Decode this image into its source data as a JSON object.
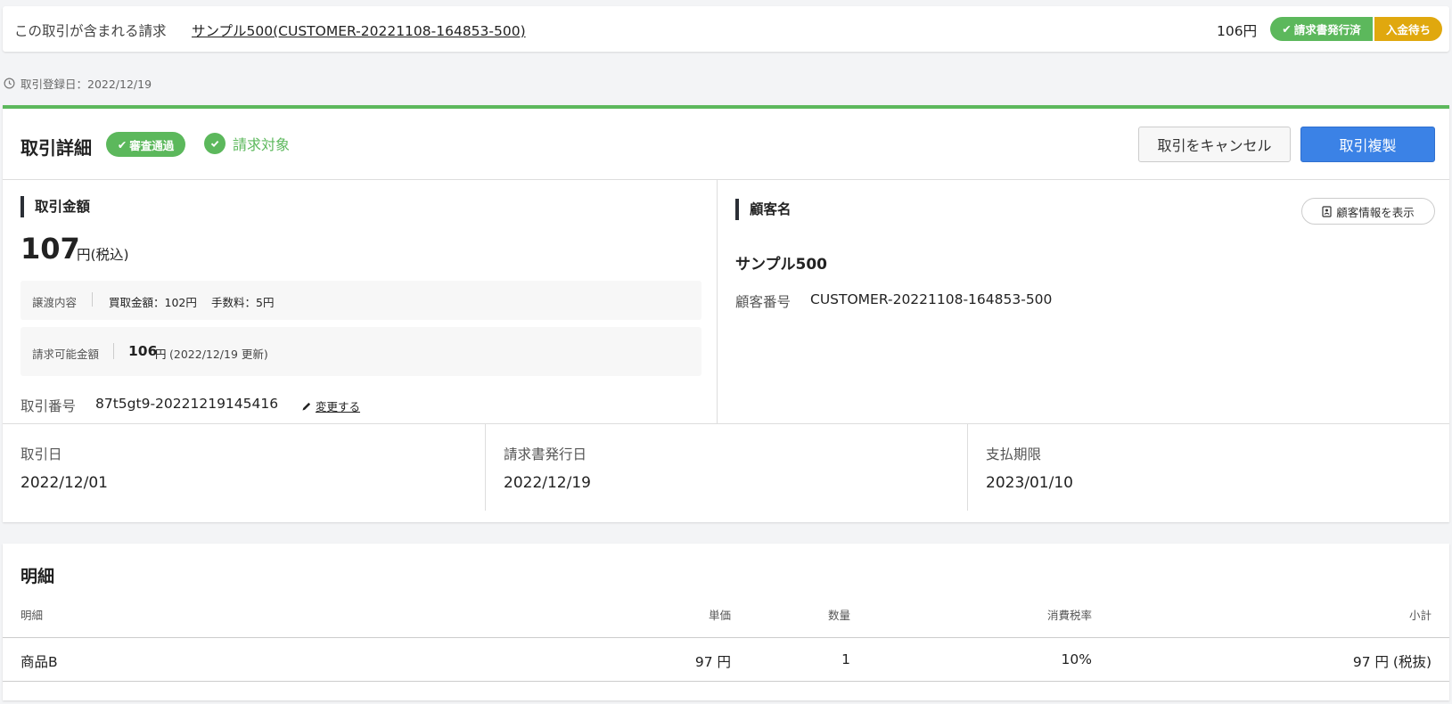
{
  "billing": {
    "label": "この取引が含まれる請求",
    "link": "サンプル500(CUSTOMER-20221108-164853-500)",
    "amount": "106円",
    "badge_issued": "請求書発行済",
    "badge_waiting": "入金待ち"
  },
  "registration": {
    "text": "取引登録日：2022/12/19"
  },
  "detail": {
    "title": "取引詳細",
    "badge_approved": "審査通過",
    "billing_target": "請求対象",
    "cancel_label": "取引をキャンセル",
    "duplicate_label": "取引複製"
  },
  "amount": {
    "label": "取引金額",
    "value": "107",
    "unit": "円(税込)",
    "transfer_label": "譲渡内容",
    "purchase": "買取金額：102円",
    "fee": "手数料：5円",
    "billable_label": "請求可能金額",
    "billable_value": "106",
    "billable_unit": "円",
    "billable_note": "(2022/12/19 更新)",
    "deal_no_label": "取引番号",
    "deal_no_value": "87t5gt9-20221219145416",
    "change_label": "変更する"
  },
  "customer": {
    "label": "顧客名",
    "show_button": "顧客情報を表示",
    "name": "サンプル500",
    "no_label": "顧客番号",
    "no_value": "CUSTOMER-20221108-164853-500"
  },
  "dates": [
    {
      "label": "取引日",
      "value": "2022/12/01"
    },
    {
      "label": "請求書発行日",
      "value": "2022/12/19"
    },
    {
      "label": "支払期限",
      "value": "2023/01/10"
    }
  ],
  "items": {
    "title": "明細",
    "headers": [
      "明細",
      "単価",
      "数量",
      "消費税率",
      "小計"
    ],
    "rows": [
      {
        "name": "商品B",
        "unit_price": "97 円",
        "qty": "1",
        "tax": "10%",
        "subtotal": "97 円 (税抜)"
      }
    ]
  },
  "colors": {
    "green": "#5cb85c",
    "amber": "#e0a80e",
    "blue": "#3b82e6"
  }
}
